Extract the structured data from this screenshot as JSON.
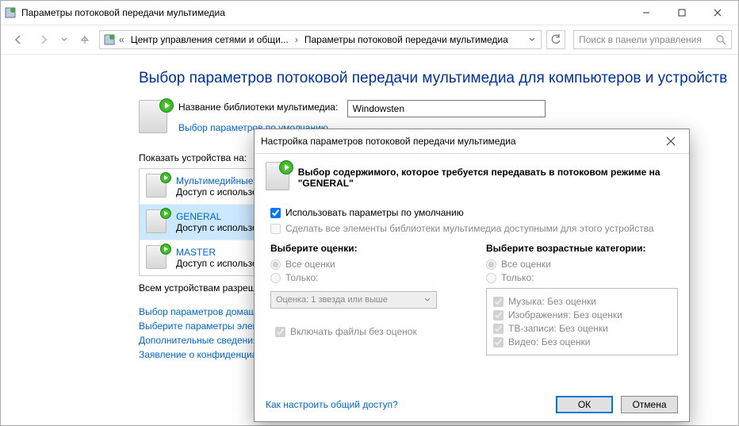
{
  "window": {
    "title": "Параметры потоковой передачи мультимедиа"
  },
  "breadcrumb": {
    "item1": "Центр управления сетями и общи...",
    "item2": "Параметры потоковой передачи мультимедиа"
  },
  "search": {
    "placeholder": "Поиск в панели управления"
  },
  "main": {
    "heading": "Выбор параметров потоковой передачи мультимедиа для компьютеров и устройств",
    "libname_label": "Название библиотеки мультимедиа:",
    "libname_value": "Windowsten",
    "choose_defaults_link": "Выбор параметров по умолчанию...",
    "show_devices_label": "Показать устройства на:",
    "all_devices": "Всем устройствам разрешена потоковая передача мультимедиа.",
    "links": {
      "l1": "Выбор параметров домашней группы...",
      "l2": "Выберите параметры электропитания...",
      "l3": "Дополнительные сведения о потоковой передаче...",
      "l4": "Заявление о конфиденциальности..."
    }
  },
  "devices": [
    {
      "name": "Мультимедийные программы на этом ПК",
      "sub": "Доступ с использованием параметров по умолчанию."
    },
    {
      "name": "GENERAL",
      "sub": "Доступ с использованием параметров по умолчанию."
    },
    {
      "name": "MASTER",
      "sub": "Доступ с использованием параметров по умолчанию."
    }
  ],
  "dialog": {
    "title": "Настройка параметров потоковой передачи мультимедиа",
    "header": "Выбор содержимого, которое требуется передавать в потоковом режиме на \"GENERAL\"",
    "use_defaults": "Использовать параметры по умолчанию",
    "make_all": "Сделать все элементы библиотеки мультимедиа доступными для этого устройства",
    "col1_head": "Выберите оценки:",
    "col2_head": "Выберите возрастные категории:",
    "radio_all": "Все оценки",
    "radio_only": "Только:",
    "combo": "Оценка: 1 звезда или выше",
    "include_unrated": "Включать файлы без оценок",
    "ratings": {
      "r1": "Музыка: Без оценки",
      "r2": "Изображения: Без оценки",
      "r3": "ТВ-записи: Без оценки",
      "r4": "Видео: Без оценки"
    },
    "help": "Как настроить общий доступ?",
    "ok": "ОК",
    "cancel": "Отмена"
  }
}
